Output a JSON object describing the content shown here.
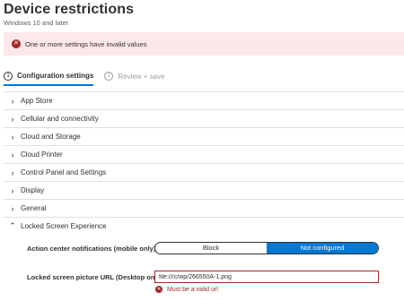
{
  "header": {
    "title": "Device restrictions",
    "subtitle": "Windows 10 and later"
  },
  "banner": {
    "message": "One or more settings have invalid values",
    "icon": "error-icon",
    "color": "#a4262c"
  },
  "steps": [
    {
      "number": "1",
      "label": "Configuration settings",
      "active": true
    },
    {
      "number": "2",
      "label": "Review + save",
      "active": false
    }
  ],
  "sections": [
    {
      "label": "App Store",
      "expanded": false
    },
    {
      "label": "Cellular and connectivity",
      "expanded": false
    },
    {
      "label": "Cloud and Storage",
      "expanded": false
    },
    {
      "label": "Cloud Printer",
      "expanded": false
    },
    {
      "label": "Control Panel and Settings",
      "expanded": false
    },
    {
      "label": "Display",
      "expanded": false
    },
    {
      "label": "General",
      "expanded": false
    },
    {
      "label": "Locked Screen Experience",
      "expanded": true
    }
  ],
  "locked_screen": {
    "action_center": {
      "label": "Action center notifications (mobile only)",
      "options": [
        "Block",
        "Not configured"
      ],
      "selected": "Not configured"
    },
    "picture_url": {
      "label": "Locked screen picture URL (Desktop only)",
      "value": "file:///c/wp/266550A-1.png",
      "error": "Must be a valid url"
    }
  },
  "colors": {
    "accent": "#0078d4",
    "error": "#a4262c",
    "error_background": "#fde7e9"
  }
}
